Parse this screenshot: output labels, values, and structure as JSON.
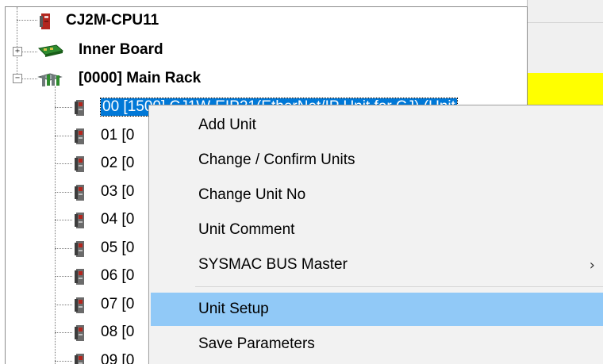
{
  "tree": {
    "cpu_label": "CJ2M-CPU11",
    "inner_board_label": "Inner Board",
    "main_rack_label": "[0000] Main Rack",
    "expander_plus": "+",
    "expander_minus": "−",
    "slots": [
      {
        "label": "00 [1500] CJ1W-EIP21(EtherNet/IP Unit for CJ) (Unit",
        "selected": true
      },
      {
        "label": "01 [0"
      },
      {
        "label": "02 [0"
      },
      {
        "label": "03 [0"
      },
      {
        "label": "04 [0"
      },
      {
        "label": "05 [0"
      },
      {
        "label": "06 [0"
      },
      {
        "label": "07 [0"
      },
      {
        "label": "08 [0"
      },
      {
        "label": "09 [0"
      }
    ]
  },
  "context_menu": {
    "items": [
      {
        "label": "Add Unit"
      },
      {
        "label": "Change / Confirm Units"
      },
      {
        "label": "Change Unit No"
      },
      {
        "label": "Unit Comment"
      },
      {
        "label": "SYSMAC BUS Master",
        "submenu_arrow": "›"
      },
      {
        "label": "Unit Setup",
        "highlighted": true
      },
      {
        "label": "Save Parameters"
      }
    ]
  },
  "colors": {
    "selection": "#0078d7",
    "menu_highlight": "#91c9f7",
    "menu_background": "#f2f2f2",
    "status_yellow": "#ffff00",
    "cpu_icon_red": "#b3261e"
  }
}
